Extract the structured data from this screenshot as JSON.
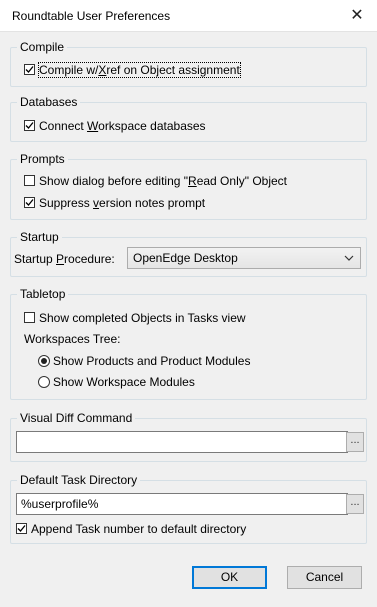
{
  "window": {
    "title": "Roundtable User Preferences",
    "close_glyph": "✕"
  },
  "compile": {
    "legend": "Compile",
    "xref": {
      "label_pre": "Compile w/",
      "label_acc": "X",
      "label_post": "ref on Object assignment",
      "checked": true
    }
  },
  "databases": {
    "legend": "Databases",
    "connect": {
      "label_pre": "Connect ",
      "label_acc": "W",
      "label_post": "orkspace databases",
      "checked": true
    }
  },
  "prompts": {
    "legend": "Prompts",
    "show_dialog": {
      "label_pre": "Show dialog before editing \"",
      "label_acc": "R",
      "label_post": "ead Only\" Object",
      "checked": false
    },
    "suppress": {
      "label_pre": "Suppress ",
      "label_acc": "v",
      "label_post": "ersion notes prompt",
      "checked": true
    }
  },
  "startup": {
    "legend": "Startup",
    "label_pre": "Startup ",
    "label_acc": "P",
    "label_post": "rocedure:",
    "value": "OpenEdge Desktop"
  },
  "tabletop": {
    "legend": "Tabletop",
    "show_completed": {
      "label": "Show completed Objects in Tasks view",
      "checked": false
    },
    "tree_label": "Workspaces Tree:",
    "radio_products": {
      "label": "Show Products and Product Modules",
      "selected": true
    },
    "radio_modules": {
      "label": "Show Workspace Modules",
      "selected": false
    }
  },
  "visual_diff": {
    "legend": "Visual Diff Command",
    "value": "",
    "browse_label": "..."
  },
  "task_dir": {
    "legend": "Default Task Directory",
    "value": "%userprofile%",
    "browse_label": "...",
    "append": {
      "label": "Append Task number to default directory",
      "checked": true
    }
  },
  "buttons": {
    "ok": "OK",
    "cancel": "Cancel"
  }
}
